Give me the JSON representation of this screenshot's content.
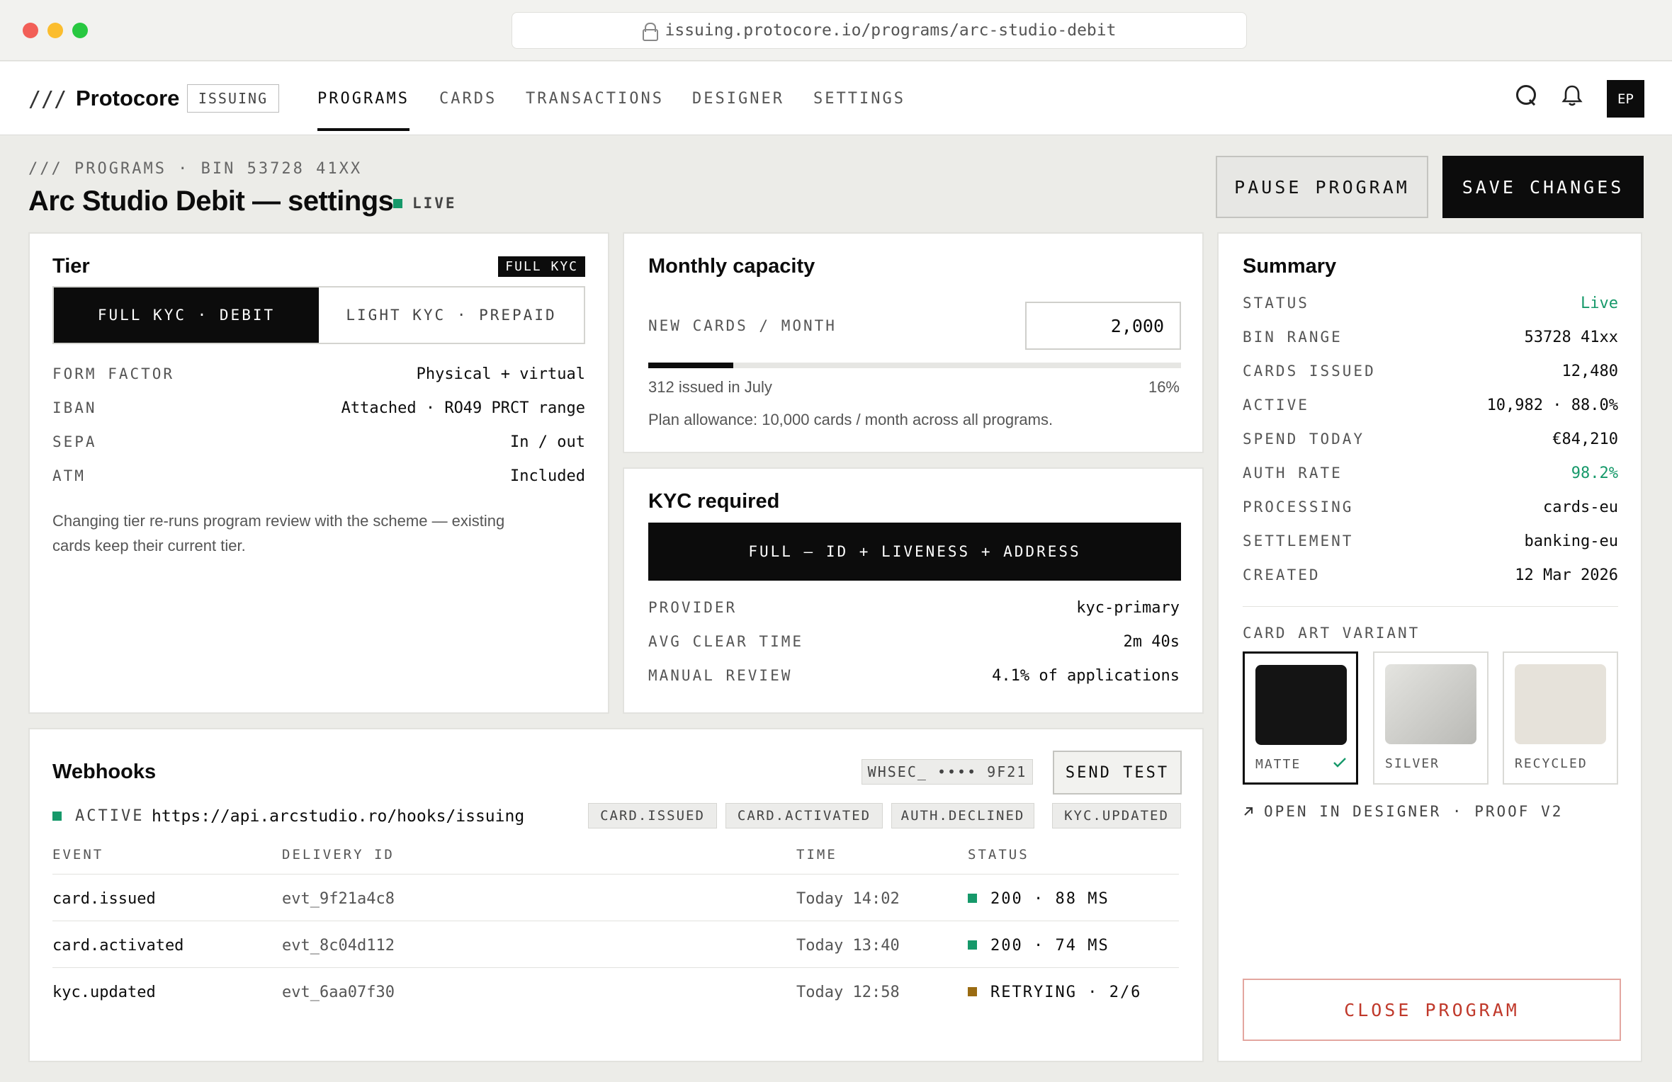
{
  "browser": {
    "url": "issuing.protocore.io/programs/arc-studio-debit"
  },
  "nav": {
    "logo_mark": "///",
    "brand": "Protocore",
    "product_badge": "ISSUING",
    "tabs": [
      "PROGRAMS",
      "CARDS",
      "TRANSACTIONS",
      "DESIGNER",
      "SETTINGS"
    ],
    "active_tab": "PROGRAMS",
    "avatar": "EP"
  },
  "header": {
    "breadcrumb": "/// PROGRAMS · BIN 53728 41XX",
    "title": "Arc Studio Debit — settings",
    "status": "LIVE",
    "pause_label": "PAUSE PROGRAM",
    "save_label": "SAVE CHANGES"
  },
  "tier": {
    "title": "Tier",
    "badge": "FULL KYC",
    "options": [
      "FULL KYC · DEBIT",
      "LIGHT KYC · PREPAID"
    ],
    "rows": [
      {
        "label": "FORM FACTOR",
        "value": "Physical + virtual"
      },
      {
        "label": "IBAN",
        "value": "Attached · RO49 PRCT range"
      },
      {
        "label": "SEPA",
        "value": "In / out"
      },
      {
        "label": "ATM",
        "value": "Included"
      }
    ],
    "note_line1": "Changing tier re-runs program review with the scheme — existing",
    "note_line2": "cards keep their current tier."
  },
  "capacity": {
    "title": "Monthly capacity",
    "label": "NEW CARDS / MONTH",
    "value": "2,000",
    "issued_text": "312 issued in July",
    "percent_text": "16%",
    "progress": 0.16,
    "allowance": "Plan allowance: 10,000 cards / month across all programs."
  },
  "kyc": {
    "title": "KYC required",
    "level": "FULL — ID + LIVENESS + ADDRESS",
    "rows": [
      {
        "label": "PROVIDER",
        "value": "kyc-primary"
      },
      {
        "label": "AVG CLEAR TIME",
        "value": "2m 40s"
      },
      {
        "label": "MANUAL REVIEW",
        "value": "4.1% of applications"
      }
    ]
  },
  "summary": {
    "title": "Summary",
    "rows": [
      {
        "label": "STATUS",
        "value": "Live"
      },
      {
        "label": "BIN RANGE",
        "value": "53728 41xx"
      },
      {
        "label": "CARDS ISSUED",
        "value": "12,480"
      },
      {
        "label": "ACTIVE",
        "value": "10,982 · 88.0%"
      },
      {
        "label": "SPEND TODAY",
        "value": "€84,210"
      },
      {
        "label": "AUTH RATE",
        "value": "98.2%"
      },
      {
        "label": "PROCESSING",
        "value": "cards-eu"
      },
      {
        "label": "SETTLEMENT",
        "value": "banking-eu"
      },
      {
        "label": "CREATED",
        "value": "12 Mar 2026"
      }
    ],
    "art_label": "CARD ART VARIANT",
    "variants": [
      "MATTE",
      "SILVER",
      "RECYCLED"
    ],
    "selected_variant": "MATTE",
    "designer_link": "OPEN IN DESIGNER · PROOF V2",
    "close_label": "CLOSE PROGRAM",
    "colors": {
      "positive": "#16996a",
      "danger": "#c0392b"
    }
  },
  "webhooks": {
    "title": "Webhooks",
    "secret": "WHSEC_ •••• 9F21",
    "send_test": "SEND TEST",
    "status": "ACTIVE",
    "endpoint": "https://api.arcstudio.ro/hooks/issuing",
    "events": [
      "CARD.ISSUED",
      "CARD.ACTIVATED",
      "AUTH.DECLINED",
      "KYC.UPDATED"
    ],
    "columns": [
      "EVENT",
      "DELIVERY ID",
      "TIME",
      "STATUS"
    ],
    "rows": [
      {
        "event": "card.issued",
        "id": "evt_9f21a4c8",
        "time": "Today 14:02",
        "status": "200 · 88 MS",
        "color": "#16996a"
      },
      {
        "event": "card.activated",
        "id": "evt_8c04d112",
        "time": "Today 13:40",
        "status": "200 · 74 MS",
        "color": "#16996a"
      },
      {
        "event": "kyc.updated",
        "id": "evt_6aa07f30",
        "time": "Today 12:58",
        "status": "RETRYING · 2/6",
        "color": "#9a6b12"
      }
    ]
  }
}
